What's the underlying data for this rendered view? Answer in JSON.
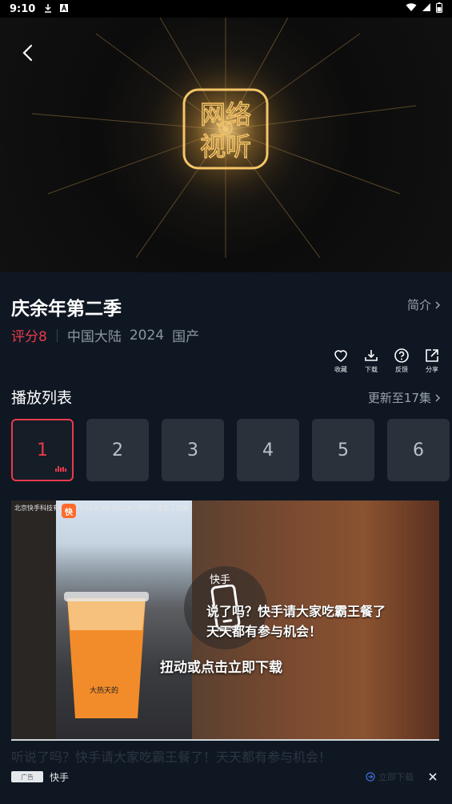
{
  "status_bar": {
    "time": "9:10",
    "icons": [
      "download-icon",
      "a-icon"
    ],
    "right_icons": [
      "wifi-icon",
      "signal-icon",
      "battery-icon"
    ]
  },
  "player": {
    "logo_text": "网络视听"
  },
  "show": {
    "title": "庆余年第二季",
    "intro_label": "简介",
    "score": "评分8",
    "region": "中国大陆",
    "year": "2024",
    "origin": "国产"
  },
  "actions": [
    {
      "label": "收藏",
      "icon": "heart-icon"
    },
    {
      "label": "下载",
      "icon": "download-icon"
    },
    {
      "label": "反馈",
      "icon": "question-icon"
    },
    {
      "label": "分享",
      "icon": "share-icon"
    }
  ],
  "playlist": {
    "title": "播放列表",
    "update_label": "更新至17集",
    "episodes": [
      "1",
      "2",
      "3",
      "4",
      "5",
      "6"
    ],
    "active_episode": "1"
  },
  "ad": {
    "source_text": "北京快手科技有限公司 | 12.4.30.36528 | 权限 | 隐私 | 功能",
    "brand_small": "快手",
    "overlay_line1": "说了吗？快手请大家吃霸王餐了",
    "overlay_line2": "天天都有参与机会！",
    "cta": "扭动或点击立即下载",
    "cup_text": "大热天的",
    "description": "听说了吗？快手请大家吃霸王餐了！天天都有参与机会！",
    "badge": "广告",
    "brand": "快手",
    "download_label": "立即下载"
  },
  "colors": {
    "accent": "#e83a4c",
    "background": "#0f1722",
    "muted_text": "#9aa3ad"
  }
}
